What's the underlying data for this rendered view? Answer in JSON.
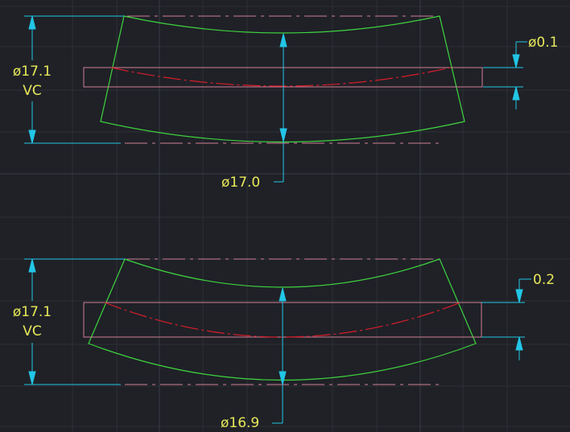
{
  "colors": {
    "background": "#1f2127",
    "grid": "#2e3138",
    "grid_major": "#3a3e46",
    "profile": "#3fd43f",
    "dimension": "#22c6e6",
    "dim_text": "#e8e85a",
    "centerline": "#d27f94",
    "cut_box": "#d27f94",
    "cut_arc": "#d81d2a"
  },
  "views": [
    {
      "label_diameter": "ø17.1",
      "label_vc": "VC",
      "bottom_dimension": "ø17.0",
      "right_dimension": "ø0.1"
    },
    {
      "label_diameter": "ø17.1",
      "label_vc": "VC",
      "bottom_dimension": "ø16.9",
      "right_dimension": "0.2"
    }
  ]
}
